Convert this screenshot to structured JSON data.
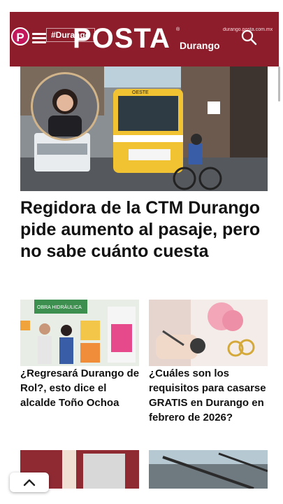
{
  "header": {
    "logo_letter": "P",
    "hashtag": "#Durango",
    "brand": "POSTA",
    "brand_reg": "®",
    "brand_sub": "Durango",
    "domain": "durango.posta.com.mx"
  },
  "hero": {
    "headline": "Regidora de la CTM Durango pide aumento al pasaje, pero no sabe cuánto cuesta",
    "bus_sign": "OESTE"
  },
  "cards": [
    {
      "title": "¿Regresará Durango de Rol?, esto dice el alcalde Toño Ochoa",
      "image_banner": "OBRA HIDRÁULICA"
    },
    {
      "title": "¿Cuáles son los requisitos para casarse GRATIS en Durango en febrero de 2026?"
    }
  ],
  "colors": {
    "header": "#8e1d2b",
    "accent": "#c2185b"
  },
  "icons": [
    "menu-icon",
    "search-icon",
    "chevron-up-icon"
  ]
}
